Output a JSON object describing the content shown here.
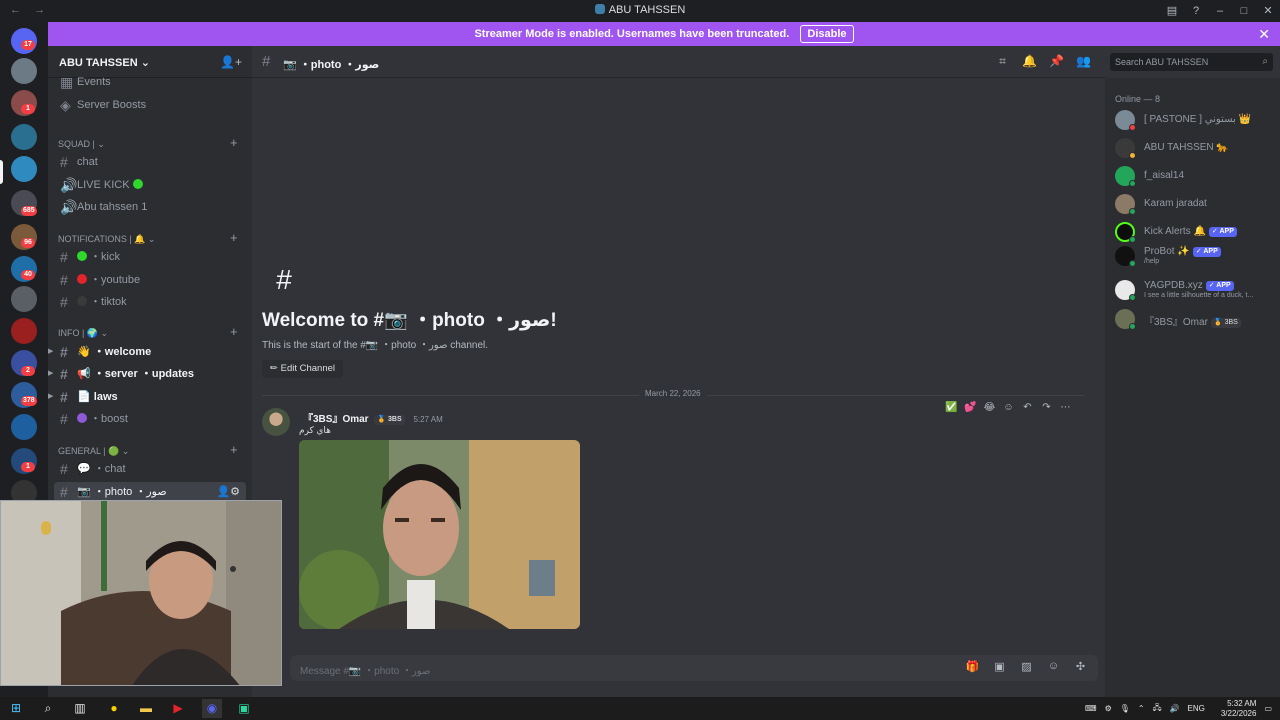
{
  "window": {
    "title": "ABU TAHSSEN",
    "back_icon": "←",
    "forward_icon": "→"
  },
  "banner": {
    "text": "Streamer Mode is enabled. Usernames have been truncated.",
    "disable_label": "Disable",
    "color": "#a155f0"
  },
  "rail": {
    "badges": [
      "17",
      "1",
      "685",
      "96",
      "40",
      "2",
      "378",
      "1"
    ]
  },
  "sidebar": {
    "server_name": "ABU TAHSSEN",
    "top_items": [
      {
        "label": "Events"
      },
      {
        "label": "Server Boosts"
      }
    ],
    "categories": {
      "squad": "Squad |",
      "notifications": "NOTIFICATIONS |",
      "info": "INFO |",
      "general": "GENERAL |"
    },
    "channels": {
      "chat": "chat",
      "live_kick": "LIVE KICK",
      "abu_tahssen_1": "Abu tahssen 1",
      "kick": "・kick",
      "youtube": "・youtube",
      "tiktok": "・tiktok",
      "welcome": "・welcome",
      "server_updates": "・server ・updates",
      "laws": "laws",
      "boost": "・boost",
      "general_chat": "・chat",
      "photo": "・photo ・صور"
    }
  },
  "chat": {
    "channel_name": "📷 ・photo ・صور",
    "welcome_title": "Welcome to #📷 ・photo ・صور!",
    "welcome_sub": "This is the start of the #📷 ・photo ・صور channel.",
    "edit_channel": "Edit Channel",
    "date_divider": "March 22, 2026",
    "message": {
      "author": "『3BS』Omar",
      "tag": "3BS",
      "time": "5:27 AM",
      "text": "هاي كرم"
    },
    "composer_placeholder": "Message #📷 ・photo ・صور"
  },
  "search": {
    "placeholder": "Search ABU TAHSSEN"
  },
  "members": {
    "header": "Online — 8",
    "list": [
      {
        "name": "[ PASTONE ] بستوني 👑",
        "sub": ""
      },
      {
        "name": "ABU TAHSSEN 🐆",
        "sub": ""
      },
      {
        "name": "f_aisal14",
        "sub": ""
      },
      {
        "name": "Karam jaradat",
        "sub": ""
      },
      {
        "name": "Kick Alerts 🔔",
        "sub": "",
        "app": "✓ APP"
      },
      {
        "name": "ProBot ✨",
        "sub": "/help",
        "app": "✓ APP"
      },
      {
        "name": "YAGPDB.xyz",
        "sub": "I see a little silhouette of a duck, t...",
        "app": "✓ APP"
      },
      {
        "name": "『3BS』Omar",
        "sub": "",
        "tag": "3BS"
      }
    ]
  },
  "taskbar": {
    "lang": "ENG",
    "time": "5:32 AM",
    "date": "3/22/2026"
  }
}
